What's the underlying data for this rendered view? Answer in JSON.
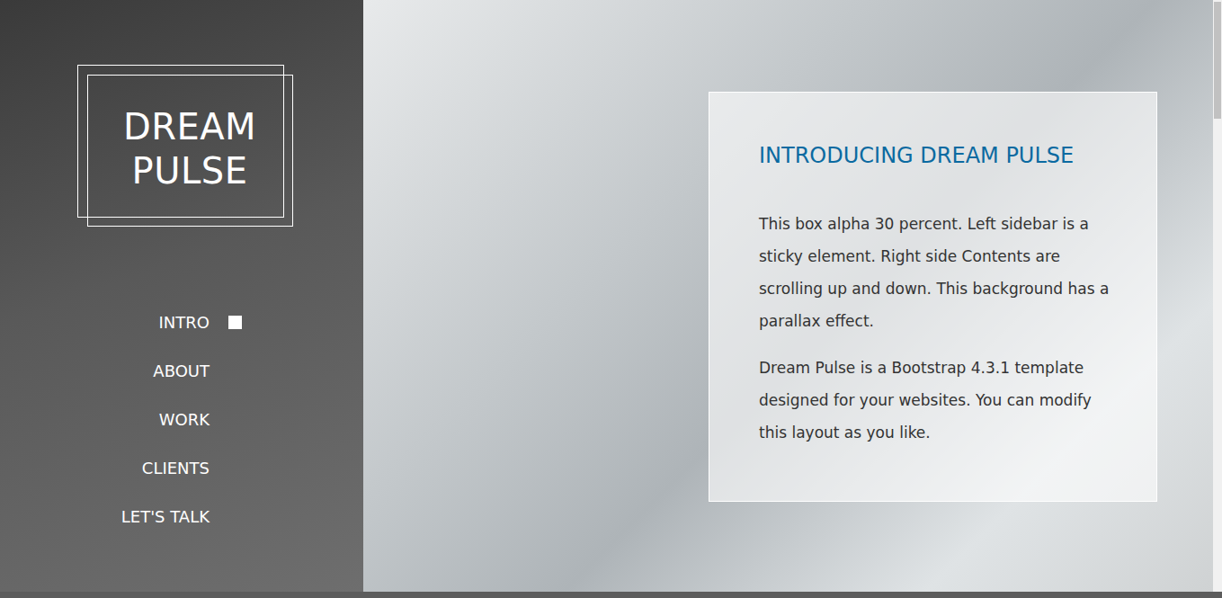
{
  "sidebar": {
    "logo": [
      "DREAM",
      "PULSE"
    ],
    "nav": [
      {
        "label": "INTRO",
        "selected": true
      },
      {
        "label": "ABOUT",
        "selected": false
      },
      {
        "label": "WORK",
        "selected": false
      },
      {
        "label": "CLIENTS",
        "selected": false
      },
      {
        "label": "LET'S TALK",
        "selected": false
      }
    ]
  },
  "content": {
    "title": "INTRODUCING DREAM PULSE",
    "paragraphs": [
      "This box alpha 30 percent. Left sidebar is a sticky element. Right side Contents are scrolling up and down. This background has a parallax effect.",
      "Dream Pulse is a Bootstrap 4.3.1 template designed for your websites. You can modify this layout as you like."
    ]
  }
}
